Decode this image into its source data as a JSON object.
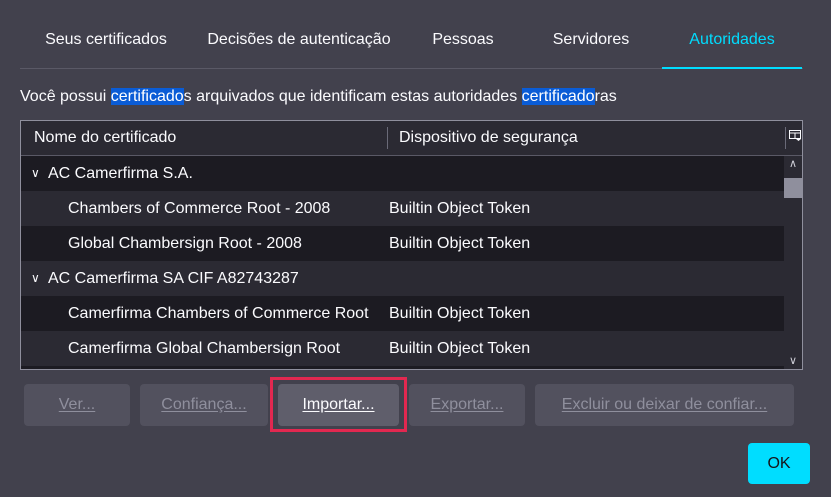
{
  "tabs": [
    {
      "label": "Seus certificados"
    },
    {
      "label": "Decisões de autenticação"
    },
    {
      "label": "Pessoas"
    },
    {
      "label": "Servidores"
    },
    {
      "label": "Autoridades"
    }
  ],
  "active_tab": "Autoridades",
  "description": {
    "part1": "Você possui ",
    "hl1": "certificado",
    "part2": "s arquivados que identificam estas autoridades ",
    "hl2": "certificado",
    "part3": "ras"
  },
  "table": {
    "columns": [
      "Nome do certificado",
      "Dispositivo de segurança"
    ],
    "picker_icon": "column-picker-icon",
    "rows": [
      {
        "type": "group",
        "name": "AC Camerfirma S.A.",
        "device": ""
      },
      {
        "type": "cert",
        "name": "Chambers of Commerce Root - 2008",
        "device": "Builtin Object Token"
      },
      {
        "type": "cert",
        "name": "Global Chambersign Root - 2008",
        "device": "Builtin Object Token"
      },
      {
        "type": "group",
        "name": "AC Camerfirma SA CIF A82743287",
        "device": ""
      },
      {
        "type": "cert",
        "name": "Camerfirma Chambers of Commerce Root",
        "device": "Builtin Object Token"
      },
      {
        "type": "cert",
        "name": "Camerfirma Global Chambersign Root",
        "device": "Builtin Object Token"
      }
    ]
  },
  "buttons": {
    "view": "Ver...",
    "trust": "Confiança...",
    "import": "Importar...",
    "export": "Exportar...",
    "delete": "Excluir ou deixar de confiar..."
  },
  "ok_label": "OK",
  "colors": {
    "accent": "#00ddff",
    "highlight": "#0a5cd6",
    "focus_box": "#e22850"
  }
}
